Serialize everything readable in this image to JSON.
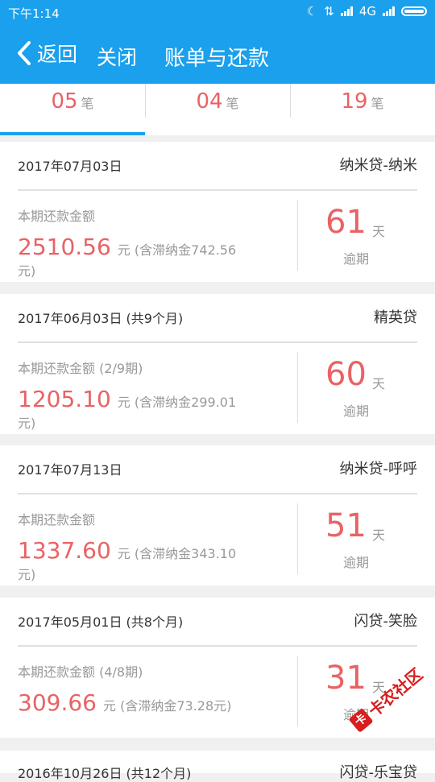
{
  "status_bar": {
    "time": "下午1:14",
    "network": "4G"
  },
  "nav": {
    "back_label": "返回",
    "close_label": "关闭",
    "title": "账单与还款"
  },
  "tabs": [
    {
      "count": "05",
      "unit": "笔",
      "selected": true
    },
    {
      "count": "04",
      "unit": "笔",
      "selected": false
    },
    {
      "count": "19",
      "unit": "笔",
      "selected": false
    }
  ],
  "bills": [
    {
      "date": "2017年07月03日",
      "lender": "纳米贷-纳米",
      "label": "本期还款金额",
      "amount": "2510.56",
      "yuan": "元",
      "fee": "(含滞纳金742.56元)",
      "days": "61",
      "days_unit": "天",
      "status": "逾期"
    },
    {
      "date": "2017年06月03日 (共9个月)",
      "lender": "精英贷",
      "label": "本期还款金额 (2/9期)",
      "amount": "1205.10",
      "yuan": "元",
      "fee": "(含滞纳金299.01元)",
      "days": "60",
      "days_unit": "天",
      "status": "逾期"
    },
    {
      "date": "2017年07月13日",
      "lender": "纳米贷-呼呼",
      "label": "本期还款金额",
      "amount": "1337.60",
      "yuan": "元",
      "fee": "(含滞纳金343.10元)",
      "days": "51",
      "days_unit": "天",
      "status": "逾期"
    },
    {
      "date": "2017年05月01日 (共8个月)",
      "lender": "闪贷-笑脸",
      "label": "本期还款金额 (4/8期)",
      "amount": "309.66",
      "yuan": "元",
      "fee": "(含滞纳金73.28元)",
      "days": "31",
      "days_unit": "天",
      "status": "逾期"
    },
    {
      "date": "2016年10月26日 (共12个月)",
      "lender": "闪贷-乐宝贷",
      "label": "",
      "amount": "",
      "yuan": "",
      "fee": "",
      "days": "",
      "days_unit": "",
      "status": ""
    }
  ],
  "watermark": {
    "logo_text": "卡",
    "text": "卡农社区"
  },
  "colors": {
    "primary": "#1aa0ec",
    "accent": "#e96265"
  }
}
